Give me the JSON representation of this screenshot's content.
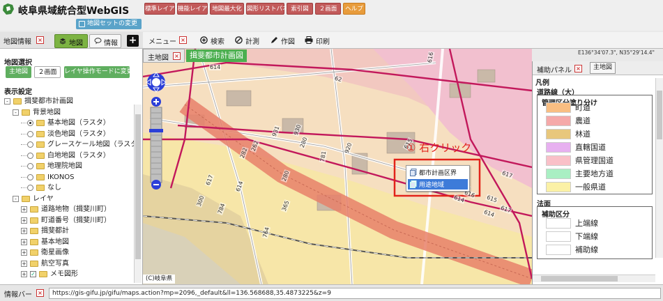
{
  "header": {
    "app_title": "岐阜県域統合型WebGIS",
    "mapset_button": "地図セットの変更",
    "toolbar": [
      {
        "label": "標準レイアウト",
        "color": "red"
      },
      {
        "label": "機能レイアウト",
        "color": "red"
      },
      {
        "label": "地図最大化",
        "color": "red"
      },
      {
        "label": "図形リストパネル",
        "color": "red"
      },
      {
        "label": "索引図",
        "color": "red"
      },
      {
        "label": "２画面",
        "color": "red"
      },
      {
        "label": "ヘルプ",
        "color": "orange"
      }
    ]
  },
  "left_panel": {
    "title": "地図情報",
    "tabs": [
      {
        "label": "地図",
        "active": true
      },
      {
        "label": "情報",
        "active": false
      }
    ],
    "add_label": "+",
    "map_select": {
      "heading": "地図選択",
      "main_map": "主地図",
      "two_screen": "２画面",
      "layer_mode": "レイヤ操作モードに変更"
    },
    "display_heading": "表示設定",
    "tree": [
      {
        "label": "揖斐都市計画図",
        "level": 0,
        "type": "folder",
        "expand": "-"
      },
      {
        "label": "背景地図",
        "level": 1,
        "type": "folder",
        "expand": "-"
      },
      {
        "label": "基本地図（ラスタ）",
        "level": 2,
        "type": "radio",
        "checked": true
      },
      {
        "label": "淡色地図（ラスタ）",
        "level": 2,
        "type": "radio",
        "checked": false
      },
      {
        "label": "グレースケール地図（ラスタ）",
        "level": 2,
        "type": "radio",
        "checked": false
      },
      {
        "label": "白地地図（ラスタ）",
        "level": 2,
        "type": "radio",
        "checked": false
      },
      {
        "label": "地理院地図",
        "level": 2,
        "type": "radio",
        "checked": false
      },
      {
        "label": "IKONOS",
        "level": 2,
        "type": "radio",
        "checked": false
      },
      {
        "label": "なし",
        "level": 2,
        "type": "radio",
        "checked": false
      },
      {
        "label": "レイヤ",
        "level": 1,
        "type": "folder",
        "expand": "-"
      },
      {
        "label": "道路地物（揖斐川町）",
        "level": 2,
        "type": "folder",
        "expand": "+"
      },
      {
        "label": "町道番号（揖斐川町）",
        "level": 2,
        "type": "folder",
        "expand": "+"
      },
      {
        "label": "揖斐都計",
        "level": 2,
        "type": "folder",
        "expand": "+"
      },
      {
        "label": "基本地図",
        "level": 2,
        "type": "folder",
        "expand": "+"
      },
      {
        "label": "衛星画像",
        "level": 2,
        "type": "folder",
        "expand": "+"
      },
      {
        "label": "航空写真",
        "level": 2,
        "type": "folder",
        "expand": "+"
      },
      {
        "label": "メモ図形",
        "level": 2,
        "type": "folder-check",
        "expand": "+"
      }
    ]
  },
  "menu": {
    "title": "メニュー",
    "items": [
      {
        "label": "検索",
        "icon": "plus-circle-icon"
      },
      {
        "label": "計測",
        "icon": "ruler-icon"
      },
      {
        "label": "作図",
        "icon": "pencil-icon"
      },
      {
        "label": "印刷",
        "icon": "printer-icon"
      }
    ]
  },
  "map": {
    "tab_label": "主地図",
    "map_name": "揖斐都市計画図",
    "coords": "E136°34'07.3\", N35°29'14.4\"",
    "copyright": "(C)岐阜県",
    "annotation": "① 右クリック",
    "context_menu": [
      {
        "label": "都市計画区界",
        "highlighted": false
      },
      {
        "label": "用途地域",
        "highlighted": true
      }
    ],
    "road_labels": [
      "614",
      "62",
      "616",
      "615",
      "931",
      "280",
      "930",
      "781",
      "920",
      "282",
      "617",
      "365",
      "280",
      "784",
      "764",
      "614",
      "615",
      "614",
      "616",
      "617",
      "300",
      "262",
      "617",
      "614"
    ]
  },
  "aux_panel": {
    "title": "補助パネル",
    "button": "主地図",
    "legend_heading": "凡例",
    "road_section": "道路線（大）",
    "road_subtitle": "管理区分塗り分け",
    "road_items": [
      {
        "label": "町道",
        "color": "#f9be82"
      },
      {
        "label": "農道",
        "color": "#f5a9a9"
      },
      {
        "label": "林道",
        "color": "#e8c77c"
      },
      {
        "label": "直轄国道",
        "color": "#e7b0f0"
      },
      {
        "label": "県管理国道",
        "color": "#f9c0c8"
      },
      {
        "label": "主要地方道",
        "color": "#a9efc3"
      },
      {
        "label": "一般県道",
        "color": "#fbf1a6"
      }
    ],
    "law_heading": "法面",
    "law_subtitle": "補助区分",
    "law_items": [
      {
        "label": "上端線",
        "color": "#ffffff"
      },
      {
        "label": "下端線",
        "color": "#ffffff"
      },
      {
        "label": "補助線",
        "color": "#ffffff"
      }
    ]
  },
  "status": {
    "label": "情報バー",
    "url": "https://gis-gifu.jp/gifu/maps.action?mp=2096,_default&ll=136.568688,35.4873225&z=9"
  }
}
